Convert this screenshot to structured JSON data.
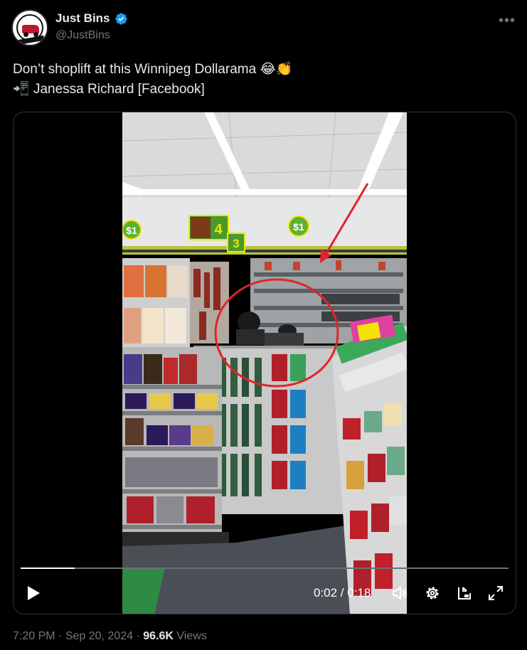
{
  "author": {
    "display_name": "Just Bins",
    "handle": "@JustBins",
    "verified": true,
    "avatar_text": "JUST BINS"
  },
  "more_icon": "more-horizontal-icon",
  "tweet": {
    "line1": "Don’t shoplift at this Winnipeg Dollarama",
    "line1_emojis": [
      "😂",
      "👏"
    ],
    "line2_prefix": "📲",
    "line2": "Janessa Richard [Facebook]"
  },
  "video": {
    "progress": 0.111,
    "current_time": "0:02",
    "duration": "0:18",
    "time_display": "0:02 / 0:18",
    "controls": [
      "play-icon",
      "volume-icon",
      "settings-gear-icon",
      "picture-in-picture-icon",
      "fullscreen-expand-icon"
    ],
    "store_signs": [
      "$1",
      "4",
      "3",
      "$1"
    ],
    "accent_red": "#e0242a",
    "sign_green": "#5cb135",
    "sign_yellow": "#f4e400"
  },
  "meta": {
    "time": "7:20 PM",
    "separator": "·",
    "date": "Sep 20, 2024",
    "views_count": "96.6K",
    "views_label": "Views"
  }
}
